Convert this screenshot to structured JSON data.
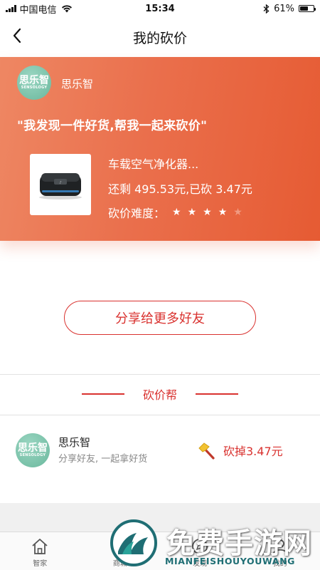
{
  "status_bar": {
    "carrier": "中国电信",
    "time": "15:34",
    "battery_text": "61%",
    "battery_level": 0.61
  },
  "nav": {
    "title": "我的砍价"
  },
  "hero": {
    "avatar_cn": "思乐智",
    "avatar_en": "SENSOLOGY",
    "username": "思乐智",
    "quote": "\"我发现一件好货,帮我一起来砍价\"",
    "product_name": "车载空气净化器...",
    "product_price": "还剩 495.53元,已砍 3.47元",
    "difficulty_label": "砍价难度：",
    "difficulty_stars": 4,
    "difficulty_max": 5
  },
  "share_button_label": "分享给更多好友",
  "section": {
    "title": "砍价帮"
  },
  "helpers": [
    {
      "avatar_cn": "思乐智",
      "avatar_en": "SENSOLOGY",
      "name": "思乐智",
      "desc": "分享好友, 一起拿好货",
      "amount": "砍掉3.47元"
    }
  ],
  "tab_bar": {
    "tabs": [
      {
        "label": "智家",
        "icon": "home-icon"
      },
      {
        "label": "商城",
        "icon": "shop-icon"
      },
      {
        "label": "发现",
        "icon": "discover-icon"
      },
      {
        "label": "我的",
        "icon": "profile-icon"
      }
    ]
  },
  "watermark": {
    "cn": "免费手游网",
    "en": "MIANFEISHOUYOUWANG"
  },
  "colors": {
    "accent": "#d9322f",
    "hero_start": "#ee8763",
    "hero_end": "#e65b33",
    "avatar": "#7cc3aa"
  }
}
